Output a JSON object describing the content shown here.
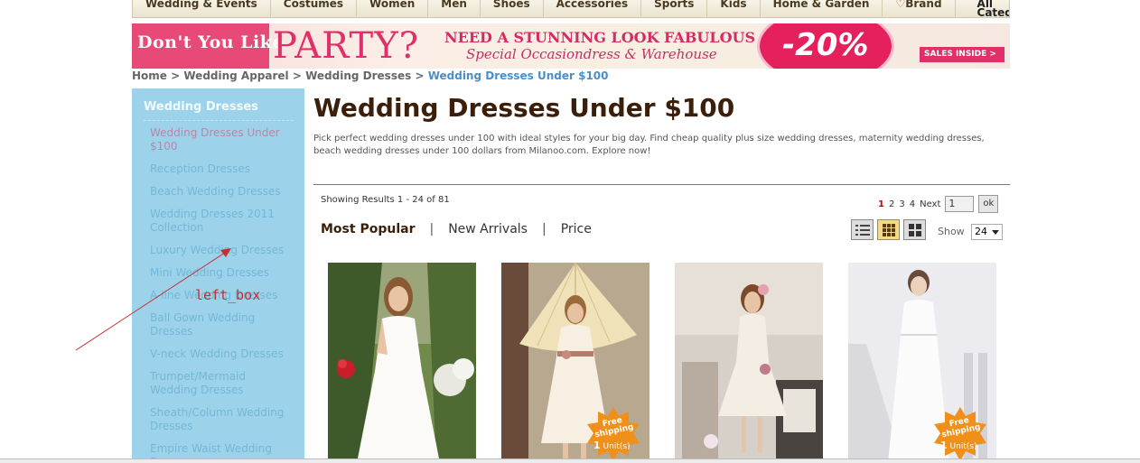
{
  "topnav": {
    "items": [
      "Wedding & Events",
      "Costumes",
      "Women",
      "Men",
      "Shoes",
      "Accessories",
      "Sports",
      "Kids",
      "Home & Garden"
    ],
    "brand": "Brand",
    "all_categories": "All Categories"
  },
  "banner": {
    "left_text": "Don't You Like",
    "party": "PARTY?",
    "headline": "NEED A STUNNING LOOK FABULOUS",
    "subline": "Special Occasiondress & Warehouse",
    "discount": "-20%",
    "sales_inside": "SALES INSIDE >"
  },
  "breadcrumb": {
    "home": "Home",
    "level1": "Wedding Apparel",
    "level2": "Wedding Dresses",
    "current": "Wedding Dresses Under $100",
    "separator": ">"
  },
  "sidebar": {
    "title": "Wedding Dresses",
    "items": [
      "Wedding Dresses Under $100",
      "Reception Dresses",
      "Beach Wedding Dresses",
      "Wedding Dresses 2011 Collection",
      "Luxury Wedding Dresses",
      "Mini Wedding Dresses",
      "A-line Wedding Dresses",
      "Ball Gown Wedding Dresses",
      "V-neck Wedding Dresses",
      "Trumpet/Mermaid Wedding Dresses",
      "Sheath/Column Wedding Dresses",
      "Empire Waist Wedding Dresses"
    ]
  },
  "annotation": {
    "label": "left_box",
    "color": "#c43030"
  },
  "main": {
    "title": "Wedding Dresses Under $100",
    "description": "Pick perfect wedding dresses under 100 with ideal styles for your big day. Find cheap quality plus size wedding dresses, maternity wedding dresses, beach wedding dresses under 100 dollars from Milanoo.com. Explore now!",
    "results_text": "Showing Results 1 - 24 of 81",
    "pager": {
      "pages": [
        "1",
        "2",
        "3",
        "4"
      ],
      "current": "1",
      "next": "Next",
      "input_value": "1",
      "ok": "ok"
    },
    "sort": {
      "popular": "Most Popular",
      "new_arrivals": "New Arrivals",
      "price": "Price",
      "separator": "|"
    },
    "view_modes": [
      "list-view-icon",
      "grid-small-view-icon",
      "grid-large-view-icon"
    ],
    "show_label": "Show",
    "show_value": "24"
  },
  "products": [
    {
      "badge": false
    },
    {
      "badge": true,
      "badge_text": "Free shipping",
      "unit_count": "1",
      "unit_label": "Unit(s)"
    },
    {
      "badge": false
    },
    {
      "badge": true,
      "badge_text": "Free shipping",
      "unit_count": "1",
      "unit_label": "Unit(s)"
    }
  ],
  "colors": {
    "accent_brown": "#3b1f0a",
    "sidebar_bg": "#9dd3ea",
    "breadcrumb_current": "#4a8fc8",
    "banner_pink": "#e0306a",
    "badge_orange": "#f0901a"
  }
}
